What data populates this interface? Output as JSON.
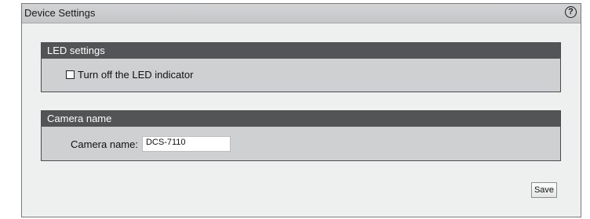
{
  "panel": {
    "title": "Device Settings",
    "help_icon": "?"
  },
  "led_settings": {
    "header": "LED settings",
    "checkbox_label": "Turn off the LED indicator",
    "checkbox_checked": false
  },
  "camera_name": {
    "header": "Camera name",
    "field_label": "Camera name:",
    "field_value": "DCS-7110"
  },
  "actions": {
    "save_label": "Save"
  },
  "colors": {
    "panel_bg": "#eeefef",
    "section_bg": "#cfd0d1",
    "section_header_bg": "#535456",
    "header_bar_bg": "#c9cacb"
  }
}
